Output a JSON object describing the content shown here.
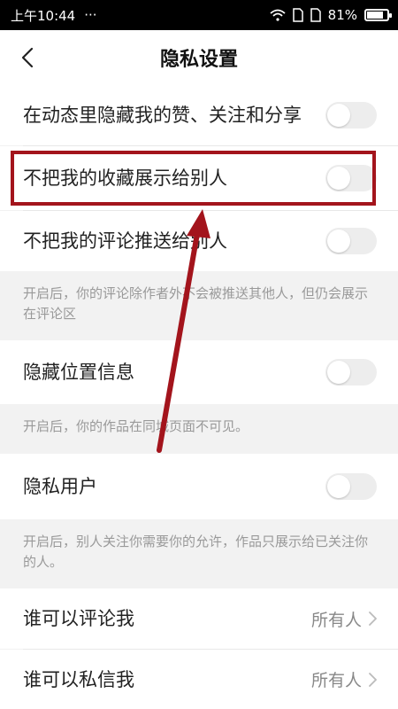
{
  "status_bar": {
    "time": "上午10:44",
    "dots": "···",
    "battery": "81%",
    "battery_level": 0.81
  },
  "header": {
    "title": "隐私设置"
  },
  "settings": {
    "hide_likes": {
      "label": "在动态里隐藏我的赞、关注和分享",
      "enabled": false
    },
    "hide_favorites": {
      "label": "不把我的收藏展示给别人",
      "enabled": false
    },
    "hide_comments": {
      "label": "不把我的评论推送给别人",
      "enabled": false,
      "hint": "开启后，你的评论除作者外不会被推送其他人，但仍会展示在评论区"
    },
    "hide_location": {
      "label": "隐藏位置信息",
      "enabled": false,
      "hint": "开启后，你的作品在同城页面不可见。"
    },
    "private_user": {
      "label": "隐私用户",
      "enabled": false,
      "hint": "开启后，别人关注你需要你的允许，作品只展示给已关注你的人。"
    },
    "who_can_comment": {
      "label": "谁可以评论我",
      "value": "所有人"
    },
    "who_can_message": {
      "label": "谁可以私信我",
      "value": "所有人"
    }
  },
  "colors": {
    "highlight": "#a3141c",
    "toggle_off": "#ededed",
    "hint_text": "#999999"
  }
}
